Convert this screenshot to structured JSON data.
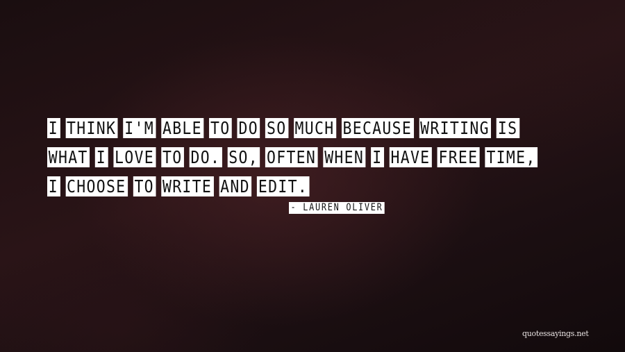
{
  "quote": {
    "lines": [
      [
        "I",
        "THINK",
        "I'M",
        "ABLE",
        "TO",
        "DO",
        "SO",
        "MUCH",
        "BECAUSE",
        "WRITING",
        "IS"
      ],
      [
        "WHAT",
        "I",
        "LOVE",
        "TO",
        "DO.",
        "SO,",
        "OFTEN",
        "WHEN",
        "I",
        "HAVE",
        "FREE",
        "TIME,"
      ],
      [
        "I",
        "CHOOSE",
        "TO",
        "WRITE",
        "AND",
        "EDIT."
      ]
    ]
  },
  "author": "- LAUREN OLIVER",
  "watermark": "quotessayings.net",
  "colors": {
    "background": "#1e1012",
    "highlight": "#ffffff",
    "text": "#111111"
  }
}
